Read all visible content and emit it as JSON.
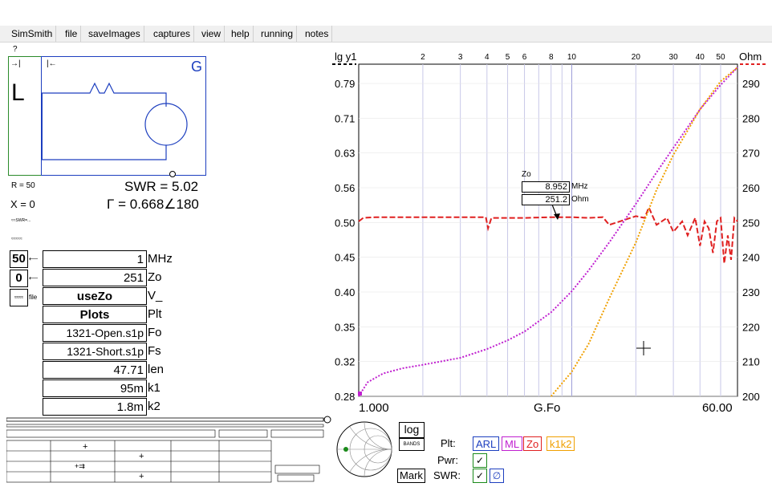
{
  "menu": [
    "SimSmith",
    "file",
    "saveImages",
    "captures",
    "view",
    "help",
    "running",
    "notes"
  ],
  "help_mark": "?",
  "schematic": {
    "load_letter": "L",
    "gen_letter": "G",
    "r_text": "R = 50",
    "x_text": "X = 0",
    "swr_text": "SWR = 5.02",
    "gamma_text": "Γ = 0.668∠180",
    "tiny_line1": "≈≈SWR=...",
    "tiny_line2": "≈≈≈≈≈"
  },
  "spins": [
    {
      "value": "50"
    },
    {
      "value": "0"
    },
    {
      "value": "≈≈≈≈"
    }
  ],
  "spin_arrow": "⟵",
  "spin_file": "file",
  "params": [
    {
      "value": "1",
      "label": "MHz"
    },
    {
      "value": "251",
      "label": "Zo"
    },
    {
      "value": "useZo",
      "label": "V_"
    },
    {
      "value": "Plots",
      "label": "Plt"
    },
    {
      "value": "1321-Open.s1p",
      "label": "Fo"
    },
    {
      "value": "1321-Short.s1p",
      "label": "Fs"
    },
    {
      "value": "47.71",
      "label": "len"
    },
    {
      "value": "95m",
      "label": "k1"
    },
    {
      "value": "1.8m",
      "label": "k2"
    }
  ],
  "plot": {
    "left_axis_title": "lg y1",
    "right_axis_title": "Ohm",
    "x_top_ticks": [
      "2",
      "3",
      "4",
      "5",
      "6",
      "8",
      "10",
      "20",
      "30",
      "40",
      "50"
    ],
    "x_left_label": "1.000",
    "x_center_label": "G.Fo",
    "x_right_label": "60.00",
    "tooltip": {
      "title": "Zo",
      "freq": "8.952",
      "freq_unit": "MHz",
      "value": "251.2",
      "value_unit": "Ohm"
    }
  },
  "chart_data": {
    "type": "line",
    "x_scale": "log",
    "xlim": [
      1,
      60
    ],
    "y_left_ticks": [
      "0.79",
      "0.71",
      "0.63",
      "0.56",
      "0.50",
      "0.45",
      "0.40",
      "0.35",
      "0.32",
      "0.28"
    ],
    "y_right_ticks": [
      "290",
      "280",
      "270",
      "260",
      "250",
      "240",
      "230",
      "220",
      "210",
      "200"
    ],
    "ylim_right": [
      200,
      294
    ],
    "series": [
      {
        "name": "Zo",
        "color": "#e02020",
        "style": "dashed",
        "x": [
          1,
          1.05,
          1.2,
          2,
          3,
          3.95,
          4.05,
          4.2,
          6,
          8,
          10,
          12,
          14,
          15,
          20,
          22,
          23,
          25,
          28,
          30,
          33,
          35,
          38,
          40,
          42,
          44,
          46,
          48,
          50,
          52,
          54,
          56,
          58,
          60
        ],
        "y": [
          250,
          251,
          251.2,
          251.2,
          251.2,
          251.2,
          248,
          251,
          251,
          251.2,
          251.2,
          251,
          251.2,
          249,
          251.5,
          251,
          254,
          249,
          251,
          247,
          250,
          246,
          251,
          243,
          250,
          248,
          241,
          250,
          251,
          238,
          246,
          239,
          251,
          250
        ]
      },
      {
        "name": "ML",
        "color": "#c020d0",
        "style": "dotted",
        "x": [
          1,
          1.1,
          1.3,
          1.6,
          2,
          3,
          4,
          5,
          6,
          8,
          10,
          12,
          15,
          20,
          25,
          30,
          40,
          50,
          60
        ],
        "y": [
          200,
          204,
          206.5,
          208,
          209,
          211,
          213.5,
          216,
          218.5,
          224,
          230,
          236,
          244,
          255,
          264,
          271,
          282,
          289,
          294
        ]
      },
      {
        "name": "k1k2",
        "color": "#f0a000",
        "style": "dotted",
        "x": [
          8,
          10,
          12,
          15,
          20,
          25,
          30,
          40,
          50,
          60
        ],
        "y": [
          200,
          207,
          215,
          228,
          244,
          259,
          269,
          282,
          290,
          294
        ]
      }
    ]
  },
  "bottom": {
    "log_label": "log",
    "bands_label": "BANDS",
    "mark_label": "Mark",
    "plt_label": "Plt:",
    "pwr_label": "Pwr:",
    "swr_label": "SWR:",
    "tags": [
      {
        "text": "ARL",
        "color": "#1d3fbf"
      },
      {
        "text": "ML",
        "color": "#c020d0"
      },
      {
        "text": "Zo",
        "color": "#e02020"
      },
      {
        "text": "k1k2",
        "color": "#f0a000"
      }
    ]
  }
}
